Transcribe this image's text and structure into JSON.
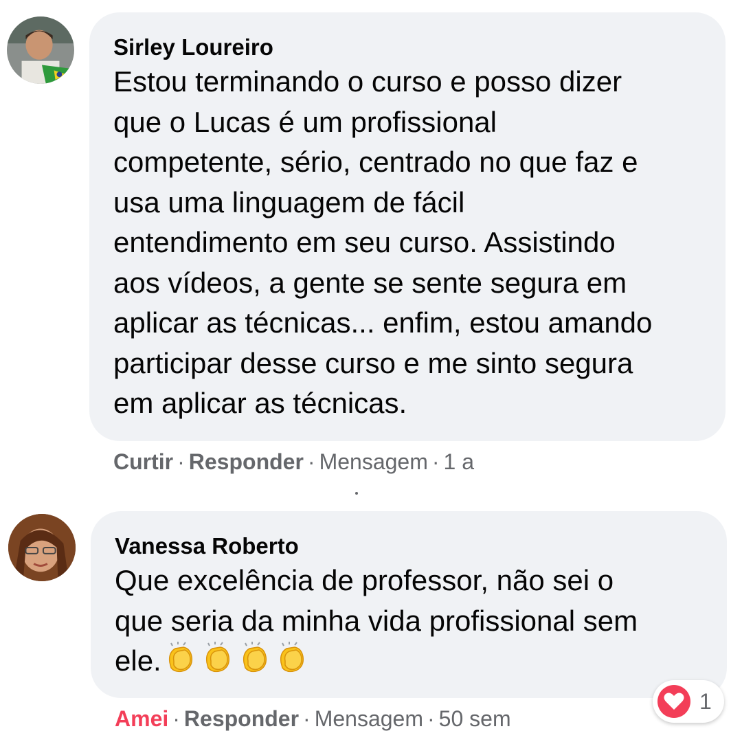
{
  "comments": [
    {
      "author": "Sirley Loureiro",
      "text_lines": [
        "Estou terminando o curso e posso dizer",
        "que o Lucas é um profissional",
        "competente, sério, centrado no que faz e",
        "usa uma linguagem de fácil",
        "entendimento em seu curso. Assistindo",
        "aos vídeos, a gente se sente segura em",
        "aplicar as técnicas... enfim, estou amando",
        "participar desse curso e me sinto segura",
        "em aplicar as técnicas."
      ],
      "actions": {
        "like": "Curtir",
        "reply": "Responder",
        "message": "Mensagem",
        "time": "1 a",
        "separator": "·"
      }
    },
    {
      "author": "Vanessa Roberto",
      "text_lines": [
        "Que excelência de professor, não sei o",
        "que seria da minha vida profissional sem",
        "ele."
      ],
      "emoji": [
        "clapping-hands",
        "clapping-hands",
        "clapping-hands",
        "clapping-hands"
      ],
      "actions": {
        "like": "Amei",
        "reply": "Responder",
        "message": "Mensagem",
        "time": "50 sem",
        "separator": "·"
      },
      "reaction": {
        "icon": "heart-icon",
        "count": "1",
        "color": "#f33e58"
      }
    }
  ],
  "colors": {
    "bubble": "#f0f2f5",
    "text": "#050505",
    "secondary": "#65676b",
    "love": "#f33e58"
  }
}
